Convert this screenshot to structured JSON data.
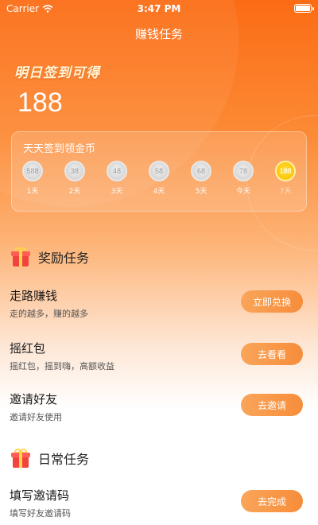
{
  "status_bar": {
    "carrier": "Carrier",
    "time": "3:47 PM"
  },
  "nav": {
    "title": "赚钱任务"
  },
  "hero": {
    "tomorrow_label": "明日签到可得",
    "amount": "188"
  },
  "checkin": {
    "title": "天天签到领金币",
    "days": [
      {
        "coins": "588",
        "label": "1天",
        "style": "silver"
      },
      {
        "coins": "38",
        "label": "2天",
        "style": "silver"
      },
      {
        "coins": "48",
        "label": "3天",
        "style": "silver"
      },
      {
        "coins": "58",
        "label": "4天",
        "style": "silver"
      },
      {
        "coins": "68",
        "label": "5天",
        "style": "silver"
      },
      {
        "coins": "78",
        "label": "今天",
        "style": "silver"
      },
      {
        "coins": "188",
        "label": "7天",
        "style": "gold"
      }
    ]
  },
  "reward_section": {
    "title": "奖励任务",
    "icon": "gift-icon",
    "tasks": [
      {
        "name": "走路赚钱",
        "desc": "走的越多，赚的越多",
        "button": "立即兑换"
      },
      {
        "name": "摇红包",
        "desc": "摇红包，摇到嗨，高额收益",
        "button": "去看看"
      },
      {
        "name": "邀请好友",
        "desc": "邀请好友使用",
        "button": "去邀请"
      }
    ]
  },
  "daily_section": {
    "title": "日常任务",
    "icon": "gift-icon",
    "tasks": [
      {
        "name": "填写邀请码",
        "desc": "填写好友邀请码",
        "button": "去完成"
      }
    ]
  },
  "colors": {
    "primary": "#fb6c14",
    "button": "#f78d3a",
    "gold": "#ffc400"
  }
}
